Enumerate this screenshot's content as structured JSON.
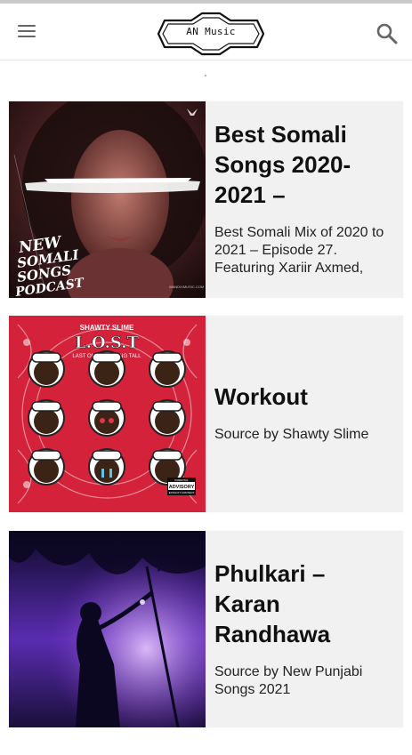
{
  "app": {
    "title": "AN Music",
    "menu_icon": "hamburger-menu-icon",
    "search_icon": "search-icon"
  },
  "posts": [
    {
      "title": "Best Somali Songs 2020-2021 –",
      "excerpt": "Best Somali Mix of 2020 to 2021 – Episode 27. Featuring Xariir Axmed,",
      "image": {
        "overlay_text": "NEW SOMALI SONGS PODCAST",
        "credit": "WANDIXMUSIC.COM"
      }
    },
    {
      "title": "Workout",
      "excerpt": "Source by Shawty Slime",
      "image": {
        "artist": "SHAWTY SLIME",
        "album": "L.O.S.T",
        "subtitle": "LAST ONE STANDING TALL",
        "advisory": "PARENTAL ADVISORY EXPLICIT CONTENT"
      }
    },
    {
      "title": "Phulkari – Karan Randhawa",
      "excerpt": "Source by New Punjabi Songs 2021",
      "image": {}
    }
  ],
  "colors": {
    "card_bg": "#f1f1f1",
    "appbar_bg": "#ffffff",
    "accent_red": "#d3223a",
    "purple": "#7a2fd0"
  }
}
